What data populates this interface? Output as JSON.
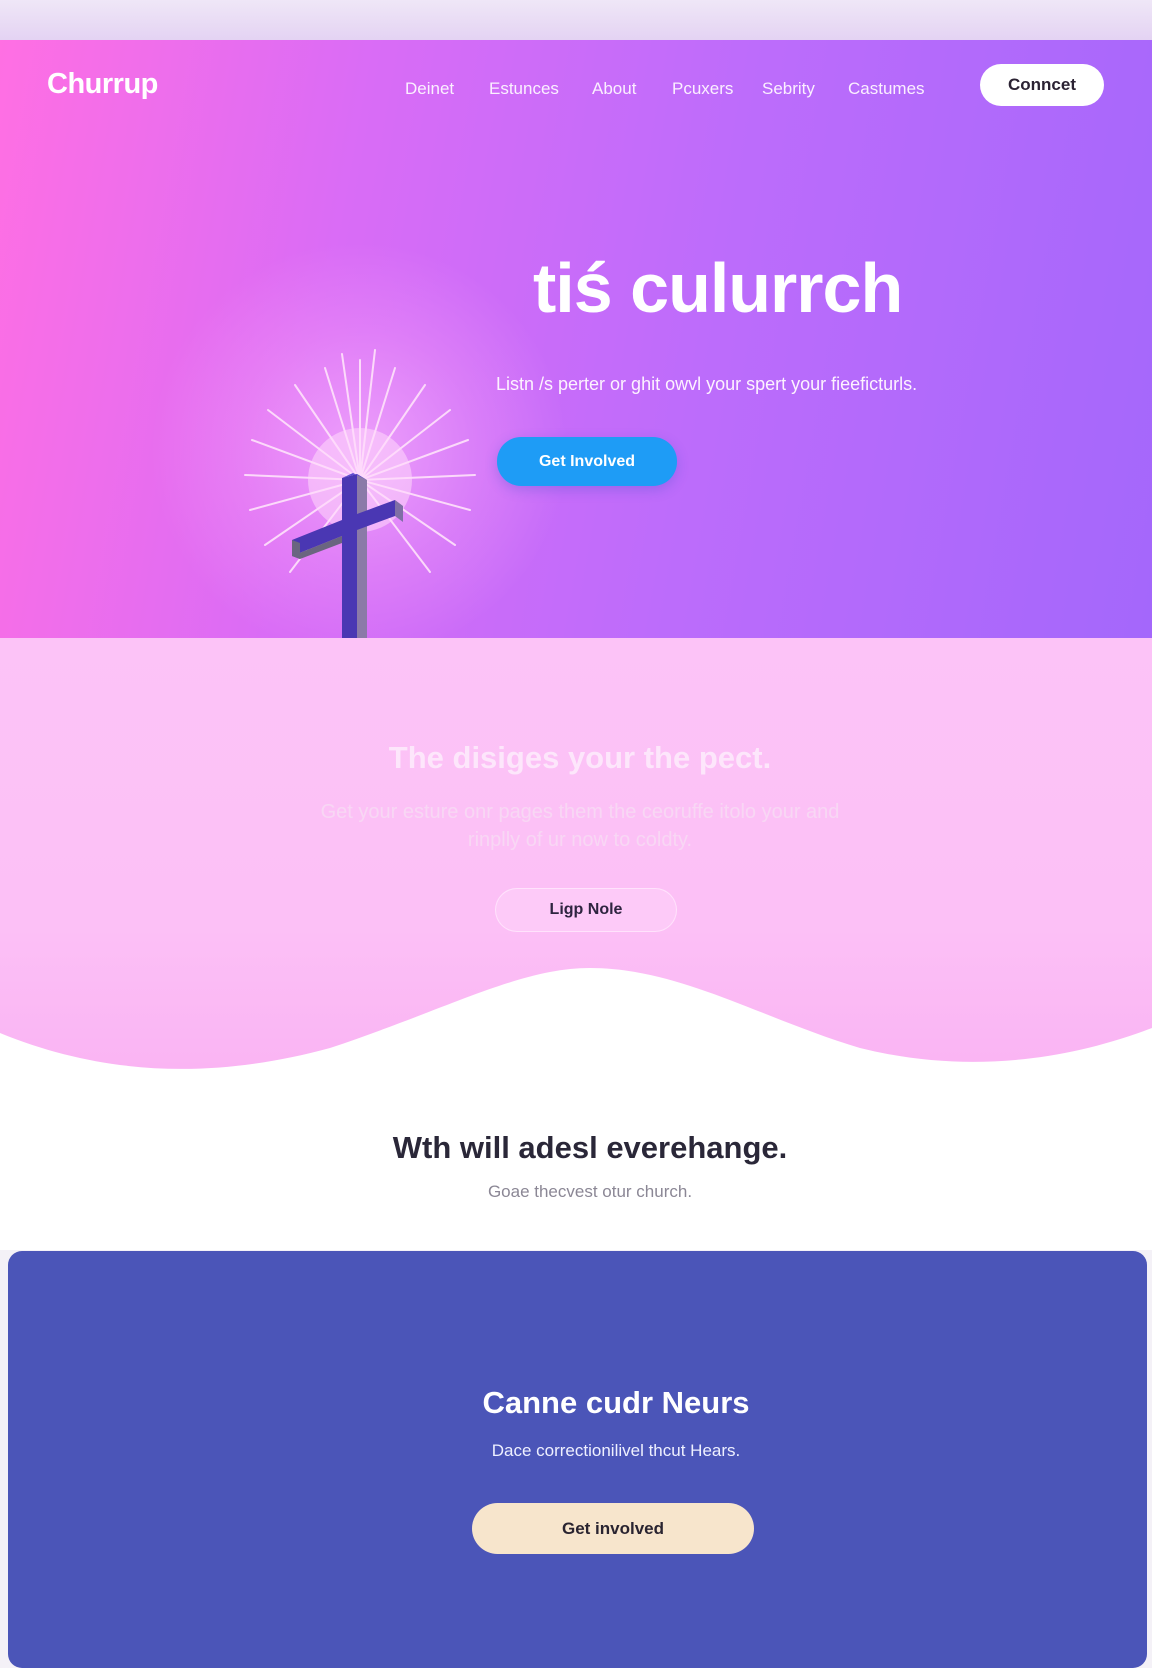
{
  "header": {
    "logo": "Churrup",
    "nav": [
      "Deinet",
      "Estunces",
      "About",
      "Pcuxers",
      "Sebrity",
      "Castumes"
    ],
    "connect_label": "Conncet"
  },
  "hero": {
    "title": "tiś culurrch",
    "subtitle": "Listn /s perter or ghit owvl your spert your fieeficturls.",
    "cta_label": "Get Involved"
  },
  "pink_section": {
    "title": "The disiges your the pect.",
    "text": "Get your esture onr pages them the ceoruffe itolo your and rinplly of ur now to coldty.",
    "button_label": "Ligp Nole"
  },
  "mid_section": {
    "title": "Wth will adesl everehange.",
    "subtitle": "Goae thecvest otur church."
  },
  "cta_card": {
    "title": "Canne cudr Neurs",
    "text": "Dace correctionilivel thcut Hears.",
    "button_label": "Get involved"
  },
  "colors": {
    "hero_gradient_start": "#ff6fe3",
    "hero_gradient_end": "#a467fb",
    "hero_button": "#1e9cf6",
    "pink_section": "#fcc3f7",
    "cta_card": "#4b55b8",
    "cta_button": "#f7e5cc",
    "cross": "#4a37b3"
  },
  "icons": {
    "hero_illustration": "cross-with-rays-icon"
  }
}
